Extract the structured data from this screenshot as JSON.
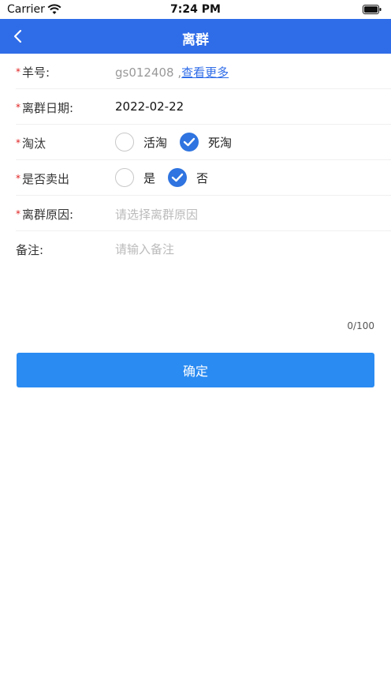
{
  "status_bar": {
    "carrier": "Carrier",
    "time": "7:24 PM"
  },
  "nav": {
    "title": "离群"
  },
  "form": {
    "sheep_no": {
      "label": "羊号:",
      "value": "gs012408 ,",
      "link": "查看更多"
    },
    "leave_date": {
      "label": "离群日期:",
      "value": "2022-02-22"
    },
    "cull": {
      "label": "淘汰",
      "options": [
        "活淘",
        "死淘"
      ],
      "selected": "死淘"
    },
    "sold": {
      "label": "是否卖出",
      "options": [
        "是",
        "否"
      ],
      "selected": "否"
    },
    "reason": {
      "label": "离群原因:",
      "placeholder": "请选择离群原因"
    },
    "remark": {
      "label": "备注:",
      "placeholder": "请输入备注",
      "counter": "0/100"
    }
  },
  "submit": {
    "label": "确定"
  },
  "colors": {
    "nav": "#2f6ce8",
    "button": "#2a8bf2",
    "required": "#e02020",
    "check": "#2f74e0"
  }
}
